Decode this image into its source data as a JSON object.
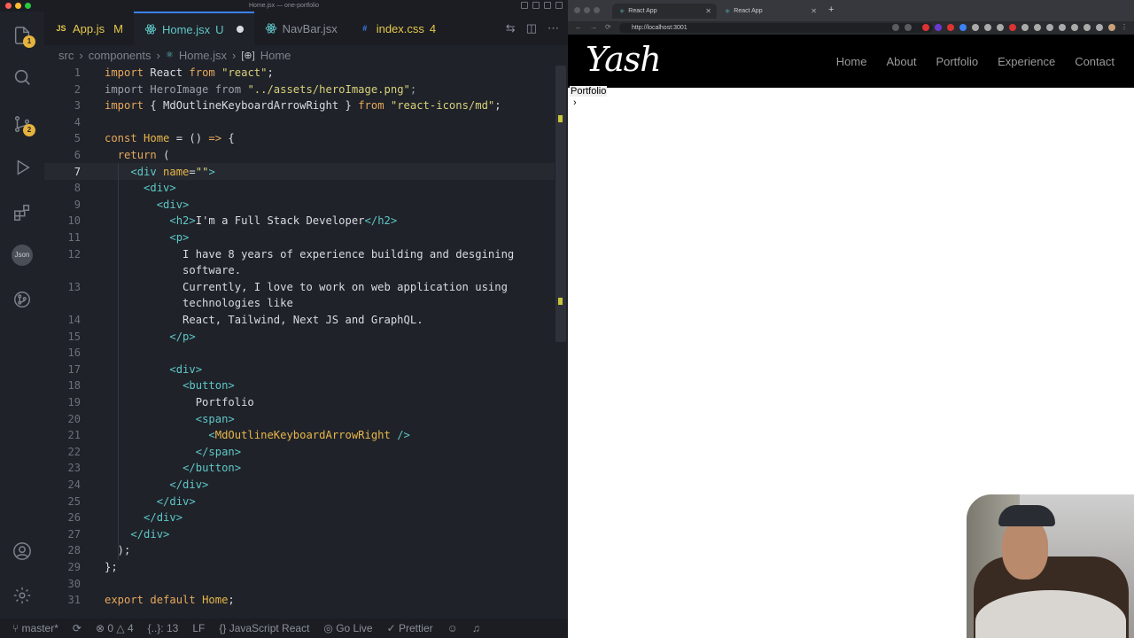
{
  "editor": {
    "window_title": "Home.jsx — one-portfolio",
    "badges": {
      "explorer": "1",
      "source_control": "2"
    },
    "json_icon_label": "Json",
    "tabs": [
      {
        "name": "App.js",
        "status": "M",
        "icon": "JS",
        "color": "#e6c84a"
      },
      {
        "name": "Home.jsx",
        "status": "U",
        "icon": "react",
        "color": "#5fc7c7"
      },
      {
        "name": "NavBar.jsx",
        "status": "",
        "icon": "react",
        "color": "#5fc7c7"
      },
      {
        "name": "index.css",
        "status": "4",
        "icon": "css",
        "color": "#3b82f6"
      }
    ],
    "breadcrumb": [
      "src",
      "components",
      "Home.jsx",
      "Home"
    ],
    "line_numbers": [
      "1",
      "2",
      "3",
      "4",
      "5",
      "6",
      "7",
      "8",
      "9",
      "10",
      "11",
      "12",
      "",
      "13",
      "",
      "14",
      "15",
      "16",
      "17",
      "18",
      "19",
      "20",
      "21",
      "22",
      "23",
      "24",
      "25",
      "26",
      "27",
      "28",
      "29",
      "30",
      "31"
    ],
    "status_bar": {
      "branch": "master*",
      "errors": "0",
      "warnings": "4",
      "selection": "{..}: 13",
      "eol": "LF",
      "language": "JavaScript React",
      "live": "Go Live",
      "formatter": "Prettier"
    }
  },
  "code": [
    [
      {
        "c": "k",
        "t": "import "
      },
      {
        "c": "w",
        "t": "React "
      },
      {
        "c": "k",
        "t": "from "
      },
      {
        "c": "s",
        "t": "\"react\""
      },
      {
        "c": "w",
        "t": ";"
      }
    ],
    [
      {
        "c": "d",
        "t": "import HeroImage from "
      },
      {
        "c": "s",
        "t": "\"../assets/heroImage.png\""
      },
      {
        "c": "d",
        "t": ";"
      }
    ],
    [
      {
        "c": "k",
        "t": "import "
      },
      {
        "c": "w",
        "t": "{ MdOutlineKeyboardArrowRight } "
      },
      {
        "c": "k",
        "t": "from "
      },
      {
        "c": "s",
        "t": "\"react-icons/md\""
      },
      {
        "c": "w",
        "t": ";"
      }
    ],
    [],
    [
      {
        "c": "k",
        "t": "const "
      },
      {
        "c": "n",
        "t": "Home "
      },
      {
        "c": "w",
        "t": "= () "
      },
      {
        "c": "k",
        "t": "=> "
      },
      {
        "c": "w",
        "t": "{"
      }
    ],
    [
      {
        "c": "w",
        "t": "  "
      },
      {
        "c": "k",
        "t": "return "
      },
      {
        "c": "w",
        "t": "("
      }
    ],
    [
      {
        "c": "w",
        "t": "    "
      },
      {
        "c": "t",
        "t": "<div "
      },
      {
        "c": "n",
        "t": "name"
      },
      {
        "c": "w",
        "t": "="
      },
      {
        "c": "s",
        "t": "\"\""
      },
      {
        "c": "t",
        "t": ">"
      }
    ],
    [
      {
        "c": "w",
        "t": "      "
      },
      {
        "c": "t",
        "t": "<div>"
      }
    ],
    [
      {
        "c": "w",
        "t": "        "
      },
      {
        "c": "t",
        "t": "<div>"
      }
    ],
    [
      {
        "c": "w",
        "t": "          "
      },
      {
        "c": "t",
        "t": "<h2>"
      },
      {
        "c": "w",
        "t": "I'm a Full Stack Developer"
      },
      {
        "c": "t",
        "t": "</h2>"
      }
    ],
    [
      {
        "c": "w",
        "t": "          "
      },
      {
        "c": "t",
        "t": "<p>"
      }
    ],
    [
      {
        "c": "w",
        "t": "            I have 8 years of experience building and desgining"
      }
    ],
    [
      {
        "c": "w",
        "t": "            software."
      }
    ],
    [
      {
        "c": "w",
        "t": "            Currently, I love to work on web application using"
      }
    ],
    [
      {
        "c": "w",
        "t": "            technologies like"
      }
    ],
    [
      {
        "c": "w",
        "t": "            React, Tailwind, Next JS and GraphQL."
      }
    ],
    [
      {
        "c": "w",
        "t": "          "
      },
      {
        "c": "t",
        "t": "</p>"
      }
    ],
    [],
    [
      {
        "c": "w",
        "t": "          "
      },
      {
        "c": "t",
        "t": "<div>"
      }
    ],
    [
      {
        "c": "w",
        "t": "            "
      },
      {
        "c": "t",
        "t": "<button>"
      }
    ],
    [
      {
        "c": "w",
        "t": "              Portfolio"
      }
    ],
    [
      {
        "c": "w",
        "t": "              "
      },
      {
        "c": "t",
        "t": "<span>"
      }
    ],
    [
      {
        "c": "w",
        "t": "                "
      },
      {
        "c": "t",
        "t": "<"
      },
      {
        "c": "n",
        "t": "MdOutlineKeyboardArrowRight "
      },
      {
        "c": "t",
        "t": "/>"
      }
    ],
    [
      {
        "c": "w",
        "t": "              "
      },
      {
        "c": "t",
        "t": "</span>"
      }
    ],
    [
      {
        "c": "w",
        "t": "            "
      },
      {
        "c": "t",
        "t": "</button>"
      }
    ],
    [
      {
        "c": "w",
        "t": "          "
      },
      {
        "c": "t",
        "t": "</div>"
      }
    ],
    [
      {
        "c": "w",
        "t": "        "
      },
      {
        "c": "t",
        "t": "</div>"
      }
    ],
    [
      {
        "c": "w",
        "t": "      "
      },
      {
        "c": "t",
        "t": "</div>"
      }
    ],
    [
      {
        "c": "w",
        "t": "    "
      },
      {
        "c": "t",
        "t": "</div>"
      }
    ],
    [
      {
        "c": "w",
        "t": "  );"
      }
    ],
    [
      {
        "c": "w",
        "t": "};"
      }
    ],
    [],
    [
      {
        "c": "k",
        "t": "export default "
      },
      {
        "c": "n",
        "t": "Home"
      },
      {
        "c": "w",
        "t": ";"
      }
    ]
  ],
  "browser": {
    "tabs": [
      "React App",
      "React App"
    ],
    "url": "http://localhost:3001",
    "site": {
      "logo": "Yash",
      "nav": [
        "Home",
        "About",
        "Portfolio",
        "Experience",
        "Contact"
      ],
      "button_label": "Portfolio",
      "arrow": "›"
    }
  }
}
